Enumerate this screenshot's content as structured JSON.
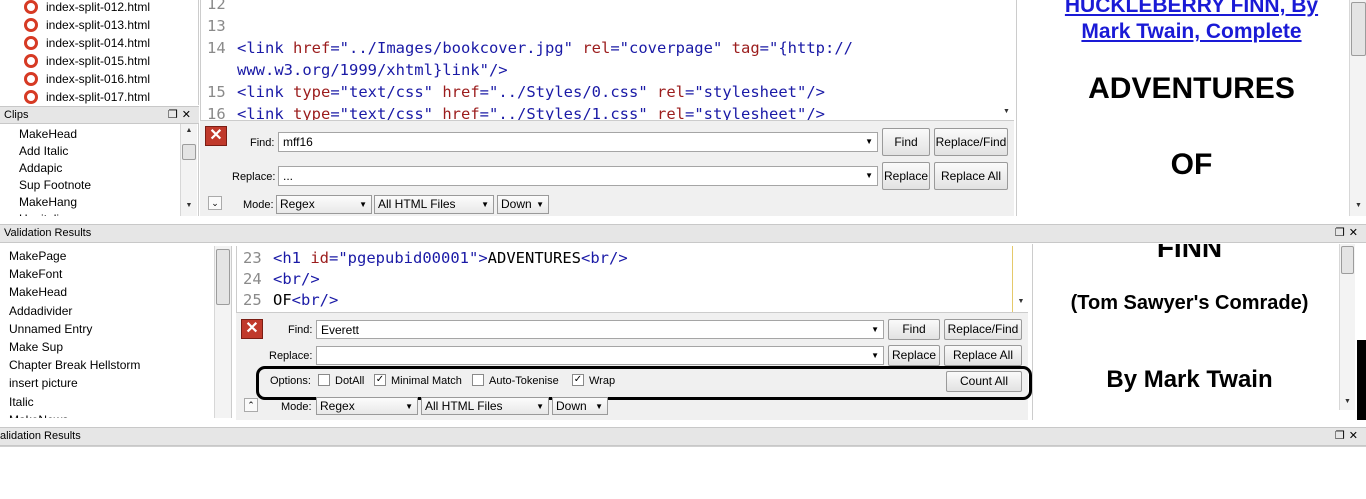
{
  "file_list": [
    {
      "label": "index-split-012.html"
    },
    {
      "label": "index-split-013.html"
    },
    {
      "label": "index-split-014.html"
    },
    {
      "label": "index-split-015.html"
    },
    {
      "label": "index-split-016.html"
    },
    {
      "label": "index-split-017.html"
    }
  ],
  "clips_panel": {
    "title": "Clips",
    "items": [
      "MakeHead",
      "Add Italic",
      "Addapic",
      "Sup Footnote",
      "MakeHang",
      "Hanitalic"
    ]
  },
  "top_code": {
    "lines": [
      {
        "num": "12",
        "segments": []
      },
      {
        "num": "13",
        "segments": []
      },
      {
        "num": "14",
        "segments": [
          {
            "c": "tag",
            "t": "<link "
          },
          {
            "c": "attr",
            "t": "href"
          },
          {
            "c": "tag",
            "t": "="
          },
          {
            "c": "val",
            "t": "\"../Images/bookcover.jpg\""
          },
          {
            "c": "tag",
            "t": " "
          },
          {
            "c": "attr",
            "t": "rel"
          },
          {
            "c": "tag",
            "t": "="
          },
          {
            "c": "val",
            "t": "\"coverpage\""
          },
          {
            "c": "tag",
            "t": " "
          },
          {
            "c": "attr",
            "t": "tag"
          },
          {
            "c": "tag",
            "t": "="
          },
          {
            "c": "val",
            "t": "\"{http://"
          }
        ]
      },
      {
        "num": "",
        "segments": [
          {
            "c": "val",
            "t": "www.w3.org/1999/xhtml}link\""
          },
          {
            "c": "tag",
            "t": "/>"
          }
        ]
      },
      {
        "num": "15",
        "segments": [
          {
            "c": "tag",
            "t": "<link "
          },
          {
            "c": "attr",
            "t": "type"
          },
          {
            "c": "tag",
            "t": "="
          },
          {
            "c": "val",
            "t": "\"text/css\""
          },
          {
            "c": "tag",
            "t": " "
          },
          {
            "c": "attr",
            "t": "href"
          },
          {
            "c": "tag",
            "t": "="
          },
          {
            "c": "val",
            "t": "\"../Styles/0.css\""
          },
          {
            "c": "tag",
            "t": " "
          },
          {
            "c": "attr",
            "t": "rel"
          },
          {
            "c": "tag",
            "t": "="
          },
          {
            "c": "val",
            "t": "\"stylesheet\""
          },
          {
            "c": "tag",
            "t": "/>"
          }
        ]
      },
      {
        "num": "16",
        "segments": [
          {
            "c": "tag",
            "t": "<link "
          },
          {
            "c": "attr",
            "t": "type"
          },
          {
            "c": "tag",
            "t": "="
          },
          {
            "c": "val",
            "t": "\"text/css\""
          },
          {
            "c": "tag",
            "t": " "
          },
          {
            "c": "attr",
            "t": "href"
          },
          {
            "c": "tag",
            "t": "="
          },
          {
            "c": "val",
            "t": "\"../Styles/1.css\""
          },
          {
            "c": "tag",
            "t": " "
          },
          {
            "c": "attr",
            "t": "rel"
          },
          {
            "c": "tag",
            "t": "="
          },
          {
            "c": "val",
            "t": "\"stylesheet\""
          },
          {
            "c": "tag",
            "t": "/>"
          }
        ]
      }
    ]
  },
  "top_find": {
    "find_label": "Find:",
    "find_value": "mff16",
    "replace_label": "Replace:",
    "replace_value": "...",
    "mode_label": "Mode:",
    "mode": "Regex",
    "scope": "All HTML Files",
    "direction": "Down",
    "find_btn": "Find",
    "replace_find_btn": "Replace/Find",
    "replace_btn": "Replace",
    "replace_all_btn": "Replace All"
  },
  "top_preview": {
    "title_line1": "HUCKLEBERRY FINN, By",
    "title_line2": "Mark Twain, Complete",
    "heading1": "ADVENTURES",
    "heading2": "OF"
  },
  "validation_bar": {
    "title": "Validation Results"
  },
  "left_list": {
    "items": [
      "MakePage",
      "MakeFont",
      "MakeHead",
      "Addadivider",
      "Unnamed Entry",
      "Make Sup",
      "Chapter Break Hellstorm",
      "insert picture",
      "Italic",
      "MakeNews"
    ]
  },
  "bottom_code": {
    "lines": [
      {
        "num": "23",
        "segments": [
          {
            "c": "tag",
            "t": "<h1 "
          },
          {
            "c": "attr",
            "t": "id"
          },
          {
            "c": "tag",
            "t": "="
          },
          {
            "c": "val",
            "t": "\"pgepubid00001\""
          },
          {
            "c": "tag",
            "t": ">"
          },
          {
            "c": "txt",
            "t": "ADVENTURES"
          },
          {
            "c": "tag",
            "t": "<br/>"
          }
        ]
      },
      {
        "num": "24",
        "segments": [
          {
            "c": "tag",
            "t": "<br/>"
          }
        ]
      },
      {
        "num": "25",
        "segments": [
          {
            "c": "txt",
            "t": "OF"
          },
          {
            "c": "tag",
            "t": "<br/>"
          }
        ]
      }
    ]
  },
  "bottom_find": {
    "find_label": "Find:",
    "find_value": "Everett",
    "replace_label": "Replace:",
    "replace_value": "",
    "options_label": "Options:",
    "dotall": "DotAll",
    "dotall_checked": false,
    "minimal": "Minimal Match",
    "minimal_checked": true,
    "autotok": "Auto-Tokenise",
    "autotok_checked": false,
    "wrap": "Wrap",
    "wrap_checked": true,
    "count_all_btn": "Count All",
    "mode_label": "Mode:",
    "mode": "Regex",
    "scope": "All HTML Files",
    "direction": "Down",
    "find_btn": "Find",
    "replace_find_btn": "Replace/Find",
    "replace_btn": "Replace",
    "replace_all_btn": "Replace All"
  },
  "bottom_preview": {
    "heading": "FINN",
    "subtitle": "(Tom Sawyer's Comrade)",
    "byline": "By Mark Twain"
  },
  "bottom_bar": {
    "title": "alidation Results"
  },
  "icons": {
    "float": "restore-icon",
    "close": "close-icon"
  },
  "colors": {
    "link": "#1a1ad6",
    "error_red": "#c0392b"
  }
}
